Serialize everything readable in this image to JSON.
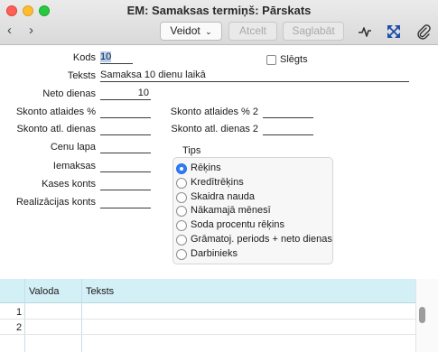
{
  "window": {
    "title": "EM: Samaksas termiņš: Pārskats"
  },
  "toolbar": {
    "back": "‹",
    "forward": "›",
    "operations": "Veidot",
    "cancel": "Atcelt",
    "save": "Saglabāt"
  },
  "form": {
    "kods_label": "Kods",
    "kods_value": "10",
    "slegts_label": "Slēgts",
    "teksts_label": "Teksts",
    "teksts_value": "Samaksa 10 dienu laikā",
    "neto_label": "Neto dienas",
    "neto_value": "10",
    "skonto_pct_label": "Skonto atlaides %",
    "skonto_pct_value": "",
    "skonto_days_label": "Skonto atl. dienas",
    "skonto_days_value": "",
    "skonto_pct2_label": "Skonto atlaides % 2",
    "skonto_pct2_value": "",
    "skonto_days2_label": "Skonto atl. dienas 2",
    "skonto_days2_value": "",
    "cenu_lapa_label": "Cenu lapa",
    "iemaksas_label": "Iemaksas",
    "kases_konts_label": "Kases konts",
    "realizacijas_label": "Realizācijas konts"
  },
  "tips": {
    "label": "Tips",
    "options": [
      {
        "label": "Rēķins",
        "selected": true
      },
      {
        "label": "Kredītrēķins",
        "selected": false
      },
      {
        "label": "Skaidra nauda",
        "selected": false
      },
      {
        "label": "Nākamajā mēnesī",
        "selected": false
      },
      {
        "label": "Soda procentu rēķins",
        "selected": false
      },
      {
        "label": "Grāmatoj. periods + neto dienas",
        "selected": false
      },
      {
        "label": "Darbinieks",
        "selected": false
      }
    ]
  },
  "grid": {
    "columns": [
      "Valoda",
      "Teksts"
    ],
    "rows": [
      "1",
      "2"
    ]
  },
  "colors": {
    "accent": "#2f7cf6",
    "grid_header": "#d4f0f7"
  }
}
